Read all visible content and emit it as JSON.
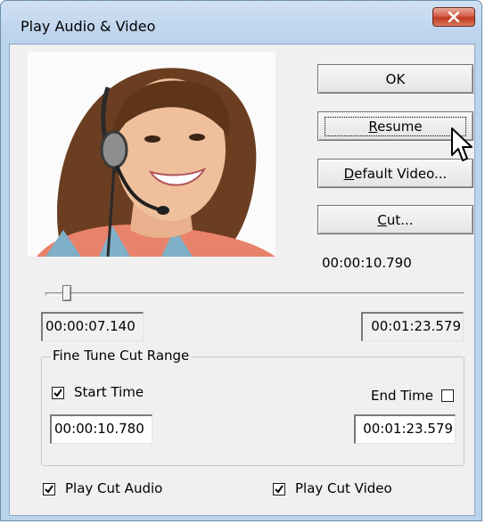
{
  "window": {
    "title": "Play Audio & Video",
    "close_glyph": "X"
  },
  "buttons": {
    "ok": "OK",
    "resume_first": "R",
    "resume_rest": "esume",
    "default_video_first": "D",
    "default_video_rest": "efault Video...",
    "cut_first": "C",
    "cut_rest": "ut..."
  },
  "current_time": "00:00:10.790",
  "slider": {
    "position_fraction": 0.05
  },
  "fields": {
    "start_position": "00:00:07.140",
    "end_position": "00:01:23.579"
  },
  "fine_tune": {
    "group_label": "Fine Tune Cut Range",
    "start_time_label": "Start Time",
    "start_time_checked": true,
    "start_time_value": "00:00:10.780",
    "end_time_label": "End Time",
    "end_time_checked": false,
    "end_time_value": "00:01:23.579"
  },
  "options": {
    "play_cut_audio_label": "Play Cut Audio",
    "play_cut_audio_checked": true,
    "play_cut_video_label": "Play Cut Video",
    "play_cut_video_checked": true
  },
  "colors": {
    "titlebar": "#bcd3ec",
    "close_button": "#c0391f",
    "dialog_face": "#f0f0f0"
  },
  "icons": {
    "close": "close-icon",
    "checkmark": "checkmark-icon",
    "cursor": "mouse-pointer-icon"
  }
}
